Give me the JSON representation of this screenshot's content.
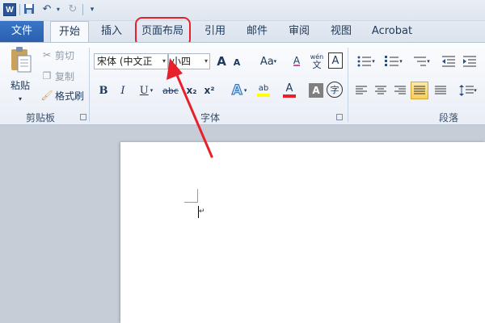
{
  "qat": {
    "logo": "W"
  },
  "tabs": [
    "文件",
    "开始",
    "插入",
    "页面布局",
    "引用",
    "邮件",
    "审阅",
    "视图",
    "Acrobat"
  ],
  "clipboard": {
    "paste_label": "粘贴",
    "cut_label": "剪切",
    "copy_label": "复制",
    "format_painter_label": "格式刷",
    "group_label": "剪贴板"
  },
  "font": {
    "font_name": "宋体 (中文正",
    "font_size": "小四",
    "group_label": "字体",
    "bold": "B",
    "italic": "I",
    "underline": "U",
    "strike": "abc",
    "subscript": "x₂",
    "superscript": "x²",
    "grow": "A",
    "shrink": "A",
    "change_case": "Aa",
    "text_effects": "A",
    "font_color": "A",
    "char_shading": "A",
    "enclose": "字",
    "phonetic_top": "wén",
    "phonetic_bottom": "文",
    "clear_format": "A",
    "char_border": "A",
    "highlight_color": "ab"
  },
  "paragraph": {
    "group_label": "段落"
  },
  "colors": {
    "accent": "#2b579a",
    "annotation_red": "#e8202a",
    "highlight_yellow": "#ffff00",
    "font_red": "#e8202a"
  }
}
